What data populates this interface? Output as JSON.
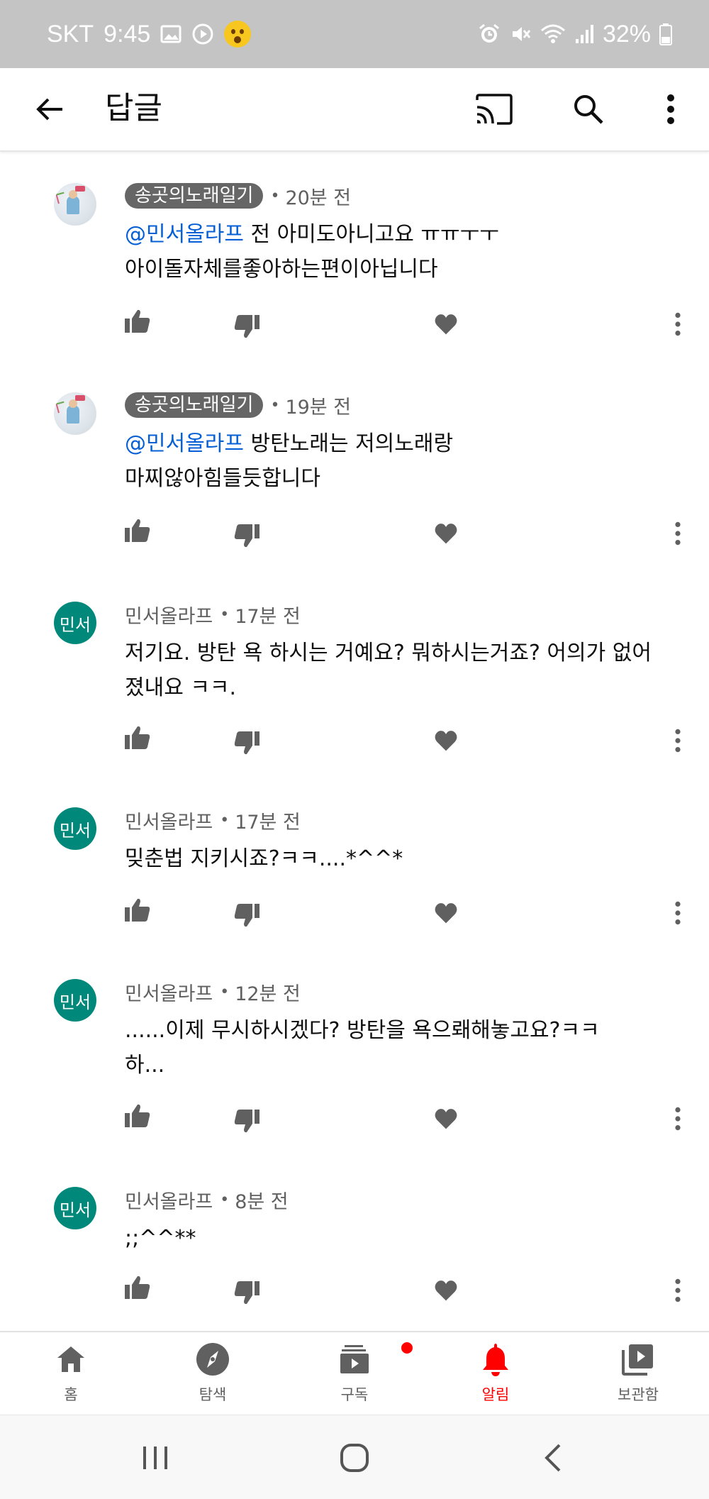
{
  "status_bar": {
    "carrier": "SKT",
    "time": "9:45",
    "battery": "32%",
    "icons": [
      "gallery-icon",
      "play-icon",
      "emoji-icon",
      "alarm-icon",
      "mute-icon",
      "wifi-icon",
      "signal-icon",
      "battery-icon"
    ]
  },
  "header": {
    "title": "답글",
    "icons": [
      "back-arrow-icon",
      "cast-icon",
      "search-icon",
      "more-vert-icon"
    ]
  },
  "comments": [
    {
      "author": "송곳의노래일기",
      "author_style": "chip",
      "time": "20분 전",
      "mention": "@민서올라프",
      "text": " 전 아미도아니고요 ㅠㅠㅜㅜ\n아이돌자체를좋아하는편이아닙니다",
      "avatar": "image"
    },
    {
      "author": "송곳의노래일기",
      "author_style": "chip",
      "time": "19분 전",
      "mention": "@민서올라프",
      "text": " 방탄노래는 저의노래랑\n마찌않아힘들듯합니다",
      "avatar": "image"
    },
    {
      "author": "민서올라프",
      "author_style": "plain",
      "time": "17분 전",
      "mention": "",
      "text": "저기요. 방탄 욕 하시는 거예요? 뭐하시는거죠? 어의가 없어졌내요 ㅋㅋ.",
      "avatar": "text",
      "avatar_text": "민서"
    },
    {
      "author": "민서올라프",
      "author_style": "plain",
      "time": "17분 전",
      "mention": "",
      "text": "밎춘법 지키시죠?ㅋㅋ....*^^*",
      "avatar": "text",
      "avatar_text": "민서"
    },
    {
      "author": "민서올라프",
      "author_style": "plain",
      "time": "12분 전",
      "mention": "",
      "text": "......이제 무시하시겠다? 방탄을 욕으뢔해놓고요?ㅋㅋ\n하...",
      "avatar": "text",
      "avatar_text": "민서"
    },
    {
      "author": "민서올라프",
      "author_style": "plain",
      "time": "8분 전",
      "mention": "",
      "text": ";;^^**",
      "avatar": "text",
      "avatar_text": "민서"
    }
  ],
  "bottom_nav": [
    {
      "label": "홈",
      "icon": "home-icon",
      "active": false
    },
    {
      "label": "탐색",
      "icon": "explore-icon",
      "active": false
    },
    {
      "label": "구독",
      "icon": "subscriptions-icon",
      "active": false,
      "badge": true
    },
    {
      "label": "알림",
      "icon": "notifications-icon",
      "active": true
    },
    {
      "label": "보관함",
      "icon": "library-icon",
      "active": false
    }
  ],
  "system_nav": [
    "recent-apps-icon",
    "home-circle-icon",
    "back-chevron-icon"
  ],
  "colors": {
    "status_bar_bg": "#c4c4c4",
    "mention": "#065fd4",
    "avatar_green": "#00897b",
    "active_red": "#ff0000",
    "chip_bg": "#666666",
    "icon_grey": "#606060"
  }
}
